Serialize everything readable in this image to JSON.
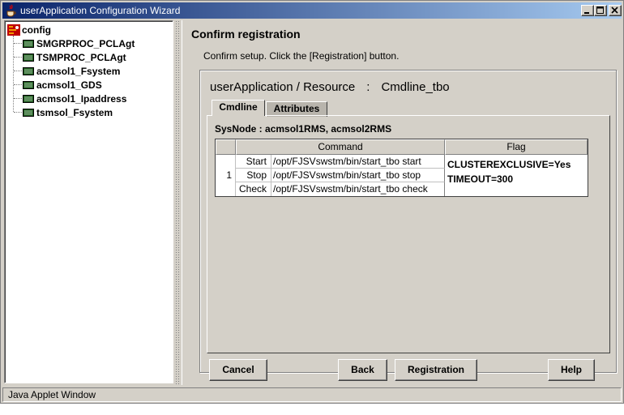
{
  "window": {
    "title": "userApplication Configuration Wizard",
    "status_text": "Java Applet Window"
  },
  "tree": {
    "root": {
      "label": "config"
    },
    "items": [
      {
        "label": "SMGRPROC_PCLAgt"
      },
      {
        "label": "TSMPROC_PCLAgt"
      },
      {
        "label": "acmsol1_Fsystem"
      },
      {
        "label": "acmsol1_GDS"
      },
      {
        "label": "acmsol1_Ipaddress"
      },
      {
        "label": "tsmsol_Fsystem"
      }
    ]
  },
  "main": {
    "title": "Confirm registration",
    "instructions": "Confirm setup.  Click the [Registration] button.",
    "resource_label": "userApplication / Resource",
    "resource_separator": ":",
    "resource_name": "Cmdline_tbo",
    "tabs": [
      {
        "label": "Cmdline",
        "active": true
      },
      {
        "label": "Attributes",
        "active": false
      }
    ],
    "sysnode": "SysNode : acmsol1RMS, acmsol2RMS",
    "table": {
      "headers": {
        "num": "",
        "command": "Command",
        "flag": "Flag"
      },
      "row_number": "1",
      "commands": [
        {
          "label": "Start",
          "path": "/opt/FJSVswstm/bin/start_tbo start"
        },
        {
          "label": "Stop",
          "path": "/opt/FJSVswstm/bin/start_tbo stop"
        },
        {
          "label": "Check",
          "path": "/opt/FJSVswstm/bin/start_tbo check"
        }
      ],
      "flags": [
        "CLUSTEREXCLUSIVE=Yes",
        "TIMEOUT=300"
      ]
    }
  },
  "buttons": {
    "cancel": "Cancel",
    "back": "Back",
    "registration": "Registration",
    "help": "Help"
  },
  "colors": {
    "window_bg": "#d4d0c8",
    "titlebar_start": "#0a246a",
    "titlebar_end": "#a6caf0"
  }
}
